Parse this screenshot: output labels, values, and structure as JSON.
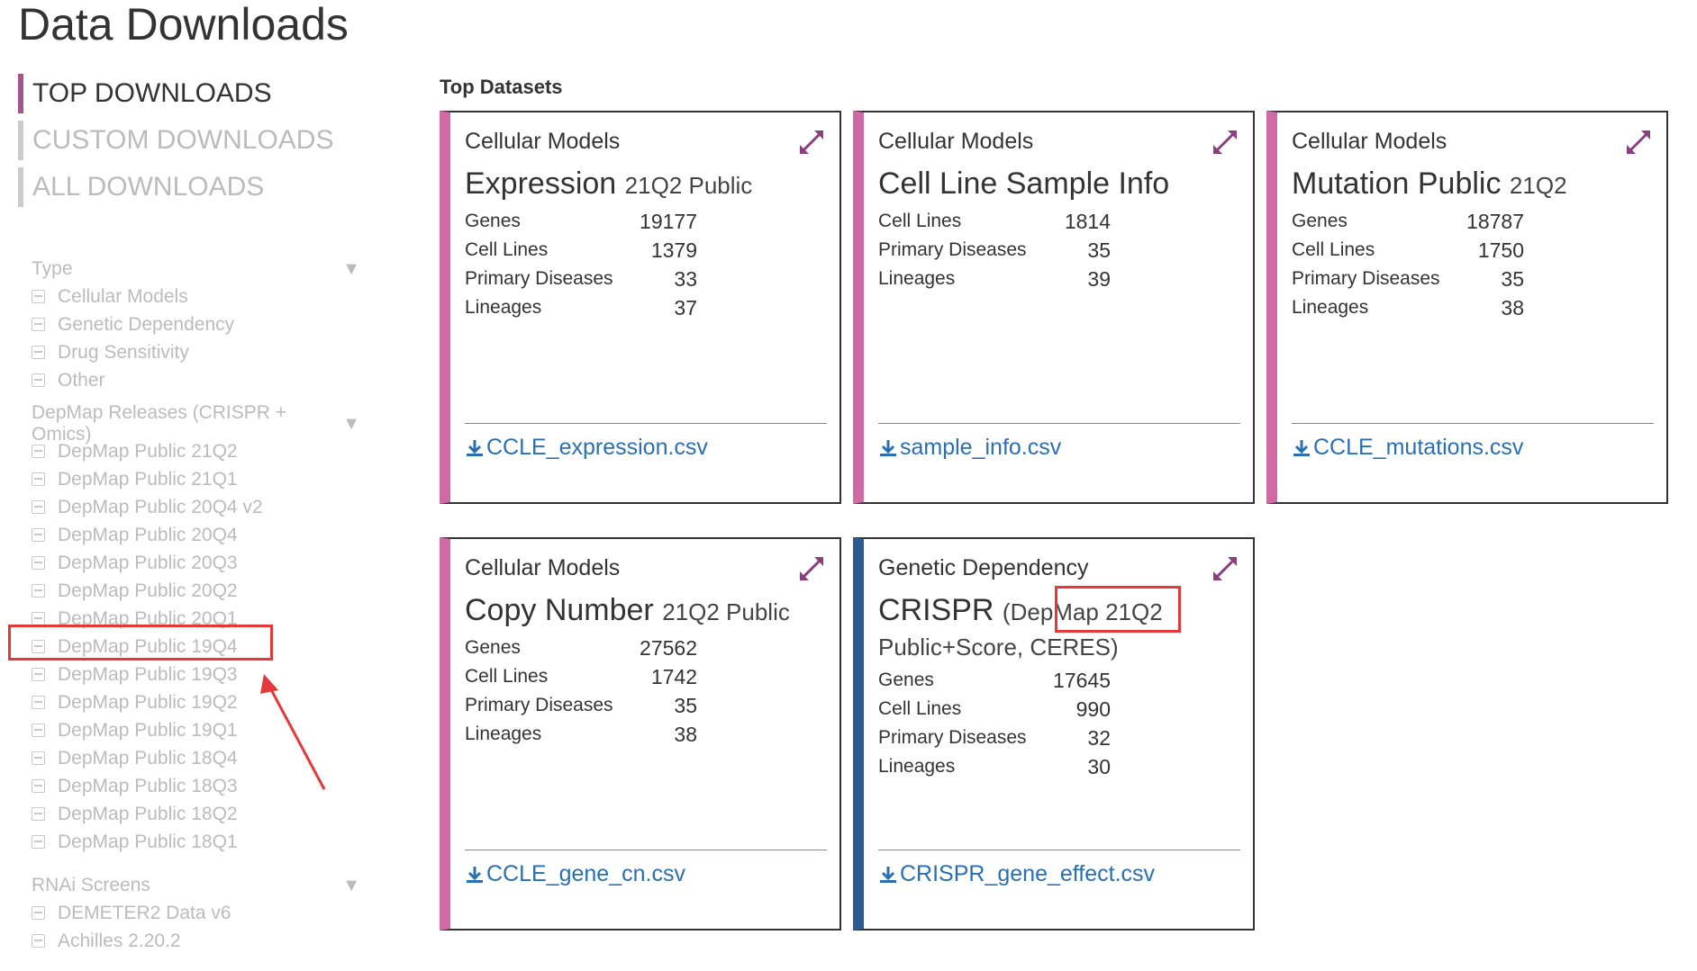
{
  "page": {
    "title": "Data Downloads"
  },
  "nav": [
    {
      "label": "TOP DOWNLOADS"
    },
    {
      "label": "CUSTOM DOWNLOADS"
    },
    {
      "label": "ALL DOWNLOADS"
    }
  ],
  "filters": {
    "type": {
      "label": "Type",
      "items": [
        "Cellular Models",
        "Genetic Dependency",
        "Drug Sensitivity",
        "Other"
      ]
    },
    "releases": {
      "label": "DepMap Releases (CRISPR + Omics)",
      "items": [
        "DepMap Public 21Q2",
        "DepMap Public 21Q1",
        "DepMap Public 20Q4 v2",
        "DepMap Public 20Q4",
        "DepMap Public 20Q3",
        "DepMap Public 20Q2",
        "DepMap Public 20Q1",
        "DepMap Public 19Q4",
        "DepMap Public 19Q3",
        "DepMap Public 19Q2",
        "DepMap Public 19Q1",
        "DepMap Public 18Q4",
        "DepMap Public 18Q3",
        "DepMap Public 18Q2",
        "DepMap Public 18Q1"
      ]
    },
    "rnai": {
      "label": "RNAi Screens",
      "items": [
        "DEMETER2 Data v6",
        "Achilles 2.20.2"
      ]
    }
  },
  "main": {
    "section_title": "Top Datasets",
    "cards": [
      {
        "category": "Cellular Models",
        "title": "Expression",
        "subtitle": "21Q2 Public",
        "stats": [
          {
            "label": "Genes",
            "value": "19177"
          },
          {
            "label": "Cell Lines",
            "value": "1379"
          },
          {
            "label": "Primary Diseases",
            "value": "33"
          },
          {
            "label": "Lineages",
            "value": "37"
          }
        ],
        "file": "CCLE_expression.csv",
        "accent": "#d06aa4"
      },
      {
        "category": "Cellular Models",
        "title": "Cell Line Sample Info",
        "subtitle": "",
        "stats": [
          {
            "label": "Cell Lines",
            "value": "1814"
          },
          {
            "label": "Primary Diseases",
            "value": "35"
          },
          {
            "label": "Lineages",
            "value": "39"
          }
        ],
        "file": "sample_info.csv",
        "accent": "#d06aa4"
      },
      {
        "category": "Cellular Models",
        "title": "Mutation Public",
        "subtitle": "21Q2",
        "stats": [
          {
            "label": "Genes",
            "value": "18787"
          },
          {
            "label": "Cell Lines",
            "value": "1750"
          },
          {
            "label": "Primary Diseases",
            "value": "35"
          },
          {
            "label": "Lineages",
            "value": "38"
          }
        ],
        "file": "CCLE_mutations.csv",
        "accent": "#d06aa4"
      },
      {
        "category": "Cellular Models",
        "title": "Copy Number",
        "subtitle": "21Q2 Public",
        "stats": [
          {
            "label": "Genes",
            "value": "27562"
          },
          {
            "label": "Cell Lines",
            "value": "1742"
          },
          {
            "label": "Primary Diseases",
            "value": "35"
          },
          {
            "label": "Lineages",
            "value": "38"
          }
        ],
        "file": "CCLE_gene_cn.csv",
        "accent": "#d06aa4"
      },
      {
        "category": "Genetic Dependency",
        "title": "CRISPR",
        "subtitle": "(DepMap 21Q2 Public+Score, CERES)",
        "stats": [
          {
            "label": "Genes",
            "value": "17645"
          },
          {
            "label": "Cell Lines",
            "value": "990"
          },
          {
            "label": "Primary Diseases",
            "value": "32"
          },
          {
            "label": "Lineages",
            "value": "30"
          }
        ],
        "file": "CRISPR_gene_effect.csv",
        "accent": "#2d5b8f"
      }
    ]
  },
  "colors": {
    "accent_pink": "#d06aa4",
    "accent_blue": "#2d5b8f",
    "nav_active": "#a0558f",
    "link": "#2a6fb1",
    "annotation_red": "#e53939"
  },
  "icons": {
    "expand": "expand-arrows-icon",
    "download": "download-icon",
    "collapse": "chevron-down-icon"
  }
}
